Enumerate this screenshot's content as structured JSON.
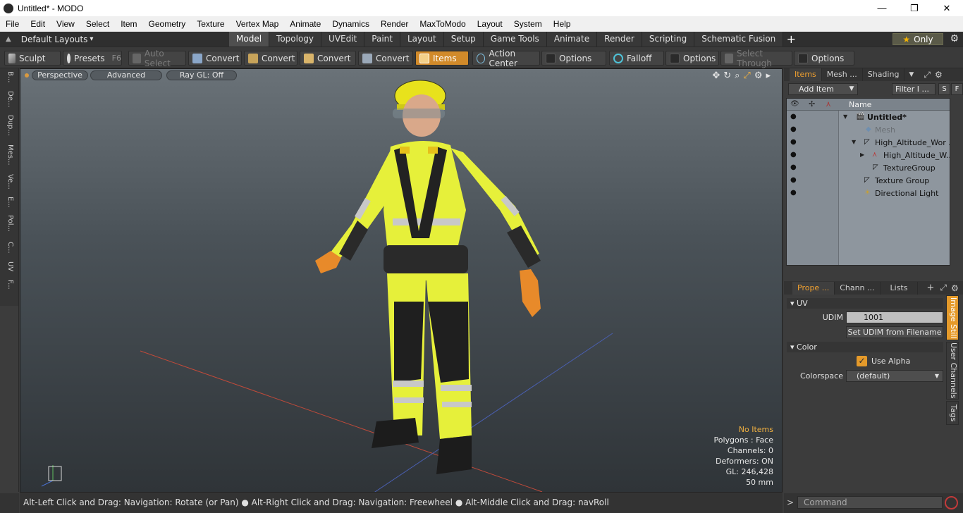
{
  "window": {
    "title": "Untitled* - MODO",
    "minimize": "—",
    "maximize": "❐",
    "close": "✕"
  },
  "menu": [
    "File",
    "Edit",
    "View",
    "Select",
    "Item",
    "Geometry",
    "Texture",
    "Vertex Map",
    "Animate",
    "Dynamics",
    "Render",
    "MaxToModo",
    "Layout",
    "System",
    "Help"
  ],
  "layouts": {
    "label": "Default Layouts",
    "arrow": "▾"
  },
  "tabs": [
    {
      "label": "Model",
      "active": true
    },
    {
      "label": "Topology",
      "active": false
    },
    {
      "label": "UVEdit",
      "active": false
    },
    {
      "label": "Paint",
      "active": false
    },
    {
      "label": "Layout",
      "active": false
    },
    {
      "label": "Setup",
      "active": false
    },
    {
      "label": "Game Tools",
      "active": false
    },
    {
      "label": "Animate",
      "active": false
    },
    {
      "label": "Render",
      "active": false
    },
    {
      "label": "Scripting",
      "active": false
    },
    {
      "label": "Schematic Fusion",
      "active": false
    }
  ],
  "only_label": "Only",
  "toolbar": {
    "sculpt": "Sculpt",
    "presets": "Presets",
    "presets_key": "F6",
    "auto_select": "Auto Select",
    "convert1": "Convert",
    "convert2": "Convert",
    "convert3": "Convert",
    "convert4": "Convert",
    "items": "Items",
    "action_center": "Action Center",
    "options1": "Options",
    "falloff": "Falloff",
    "options2": "Options",
    "select_through": "Select Through",
    "options3": "Options"
  },
  "left_tabs": [
    "B...",
    "De...",
    "Dup...",
    "Mes...",
    "Ve...",
    "E...",
    "Pol...",
    "C...",
    "UV",
    "F..."
  ],
  "viewport": {
    "perspective": "Perspective",
    "advanced": "Advanced",
    "raygl": "Ray GL: Off",
    "info": {
      "no_items": "No Items",
      "polygons": "Polygons : Face",
      "channels": "Channels: 0",
      "deformers": "Deformers: ON",
      "gl": "GL: 246,428",
      "focal": "50 mm"
    }
  },
  "items_panel": {
    "tabs": [
      "Items",
      "Mesh ...",
      "Shading"
    ],
    "add_item": "Add Item",
    "filter": "Filter I ...",
    "s_btn": "S",
    "f_btn": "F",
    "name_col": "Name",
    "rows": [
      {
        "label": "Untitled*",
        "indent": 0,
        "bold": true,
        "disabled": false,
        "tri": "▼"
      },
      {
        "label": "Mesh",
        "indent": 1,
        "bold": false,
        "disabled": true,
        "tri": ""
      },
      {
        "label": "High_Altitude_Wor ...",
        "indent": 1,
        "bold": false,
        "disabled": false,
        "tri": "▼"
      },
      {
        "label": "High_Altitude_W...",
        "indent": 2,
        "bold": false,
        "disabled": false,
        "tri": "▶"
      },
      {
        "label": "TextureGroup",
        "indent": 2,
        "bold": false,
        "disabled": false,
        "tri": ""
      },
      {
        "label": "Texture Group",
        "indent": 1,
        "bold": false,
        "disabled": false,
        "tri": ""
      },
      {
        "label": "Directional Light",
        "indent": 1,
        "bold": false,
        "disabled": false,
        "tri": ""
      }
    ]
  },
  "props_panel": {
    "tabs": [
      "Prope ...",
      "Chann ...",
      "Lists"
    ],
    "uv_section": "UV",
    "udim_label": "UDIM",
    "udim_value": "1001",
    "set_udim": "Set UDIM from Filename",
    "color_section": "Color",
    "use_alpha": "Use Alpha",
    "colorspace_label": "Colorspace",
    "colorspace_value": "(default)",
    "side_tabs": [
      "Image Still",
      "User Channels",
      "Tags"
    ]
  },
  "status": "Alt-Left Click and Drag: Navigation: Rotate (or Pan) ● Alt-Right Click and Drag: Navigation: Freewheel ● Alt-Middle Click and Drag: navRoll",
  "command_placeholder": "Command",
  "colors": {
    "accent": "#e59a2a",
    "viewport_top": "#6a7278",
    "viewport_bottom": "#2f3438",
    "hi_vis_yellow": "#e6f03a"
  }
}
